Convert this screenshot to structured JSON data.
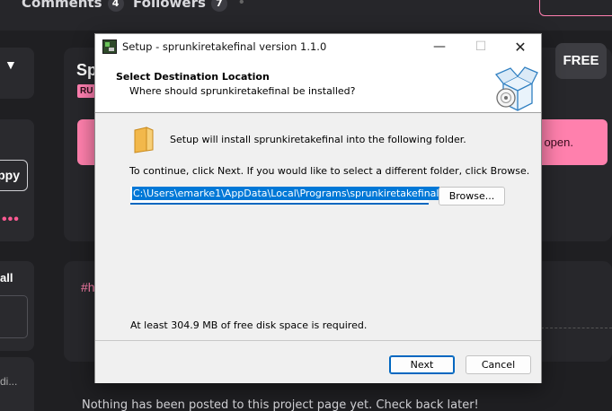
{
  "background_page": {
    "tabs": [
      {
        "label": "Comments",
        "count": "4"
      },
      {
        "label": "Followers",
        "count": "7"
      }
    ],
    "sidebar": {
      "happy_button": "ppy",
      "all_label": "all",
      "di_label": "di..."
    },
    "project": {
      "title_fragment": "Sp",
      "tag": "RU",
      "free_badge": "FREE",
      "banner_fragment": "open.",
      "hashtag_fragment": "#h",
      "empty_message": "Nothing has been posted to this project page yet. Check back later!"
    }
  },
  "dialog": {
    "title": "Setup - sprunkiretakefinal version 1.1.0",
    "window_controls": {
      "minimize": "—",
      "maximize": "☐",
      "close": "✕"
    },
    "header": {
      "title": "Select Destination Location",
      "subtitle": "Where should sprunkiretakefinal be installed?"
    },
    "intro": "Setup will install sprunkiretakefinal into the following folder.",
    "continue_text": "To continue, click Next. If you would like to select a different folder, click Browse.",
    "path_value": "C:\\Users\\emarke1\\AppData\\Local\\Programs\\sprunkiretakefinal",
    "browse_label": "Browse...",
    "disk_space": "At least 304.9 MB of free disk space is required.",
    "next_label": "Next",
    "cancel_label": "Cancel"
  },
  "colors": {
    "accent_pink": "#ff80ad",
    "focus_blue": "#0067c0",
    "selection_blue": "#0078d7"
  }
}
